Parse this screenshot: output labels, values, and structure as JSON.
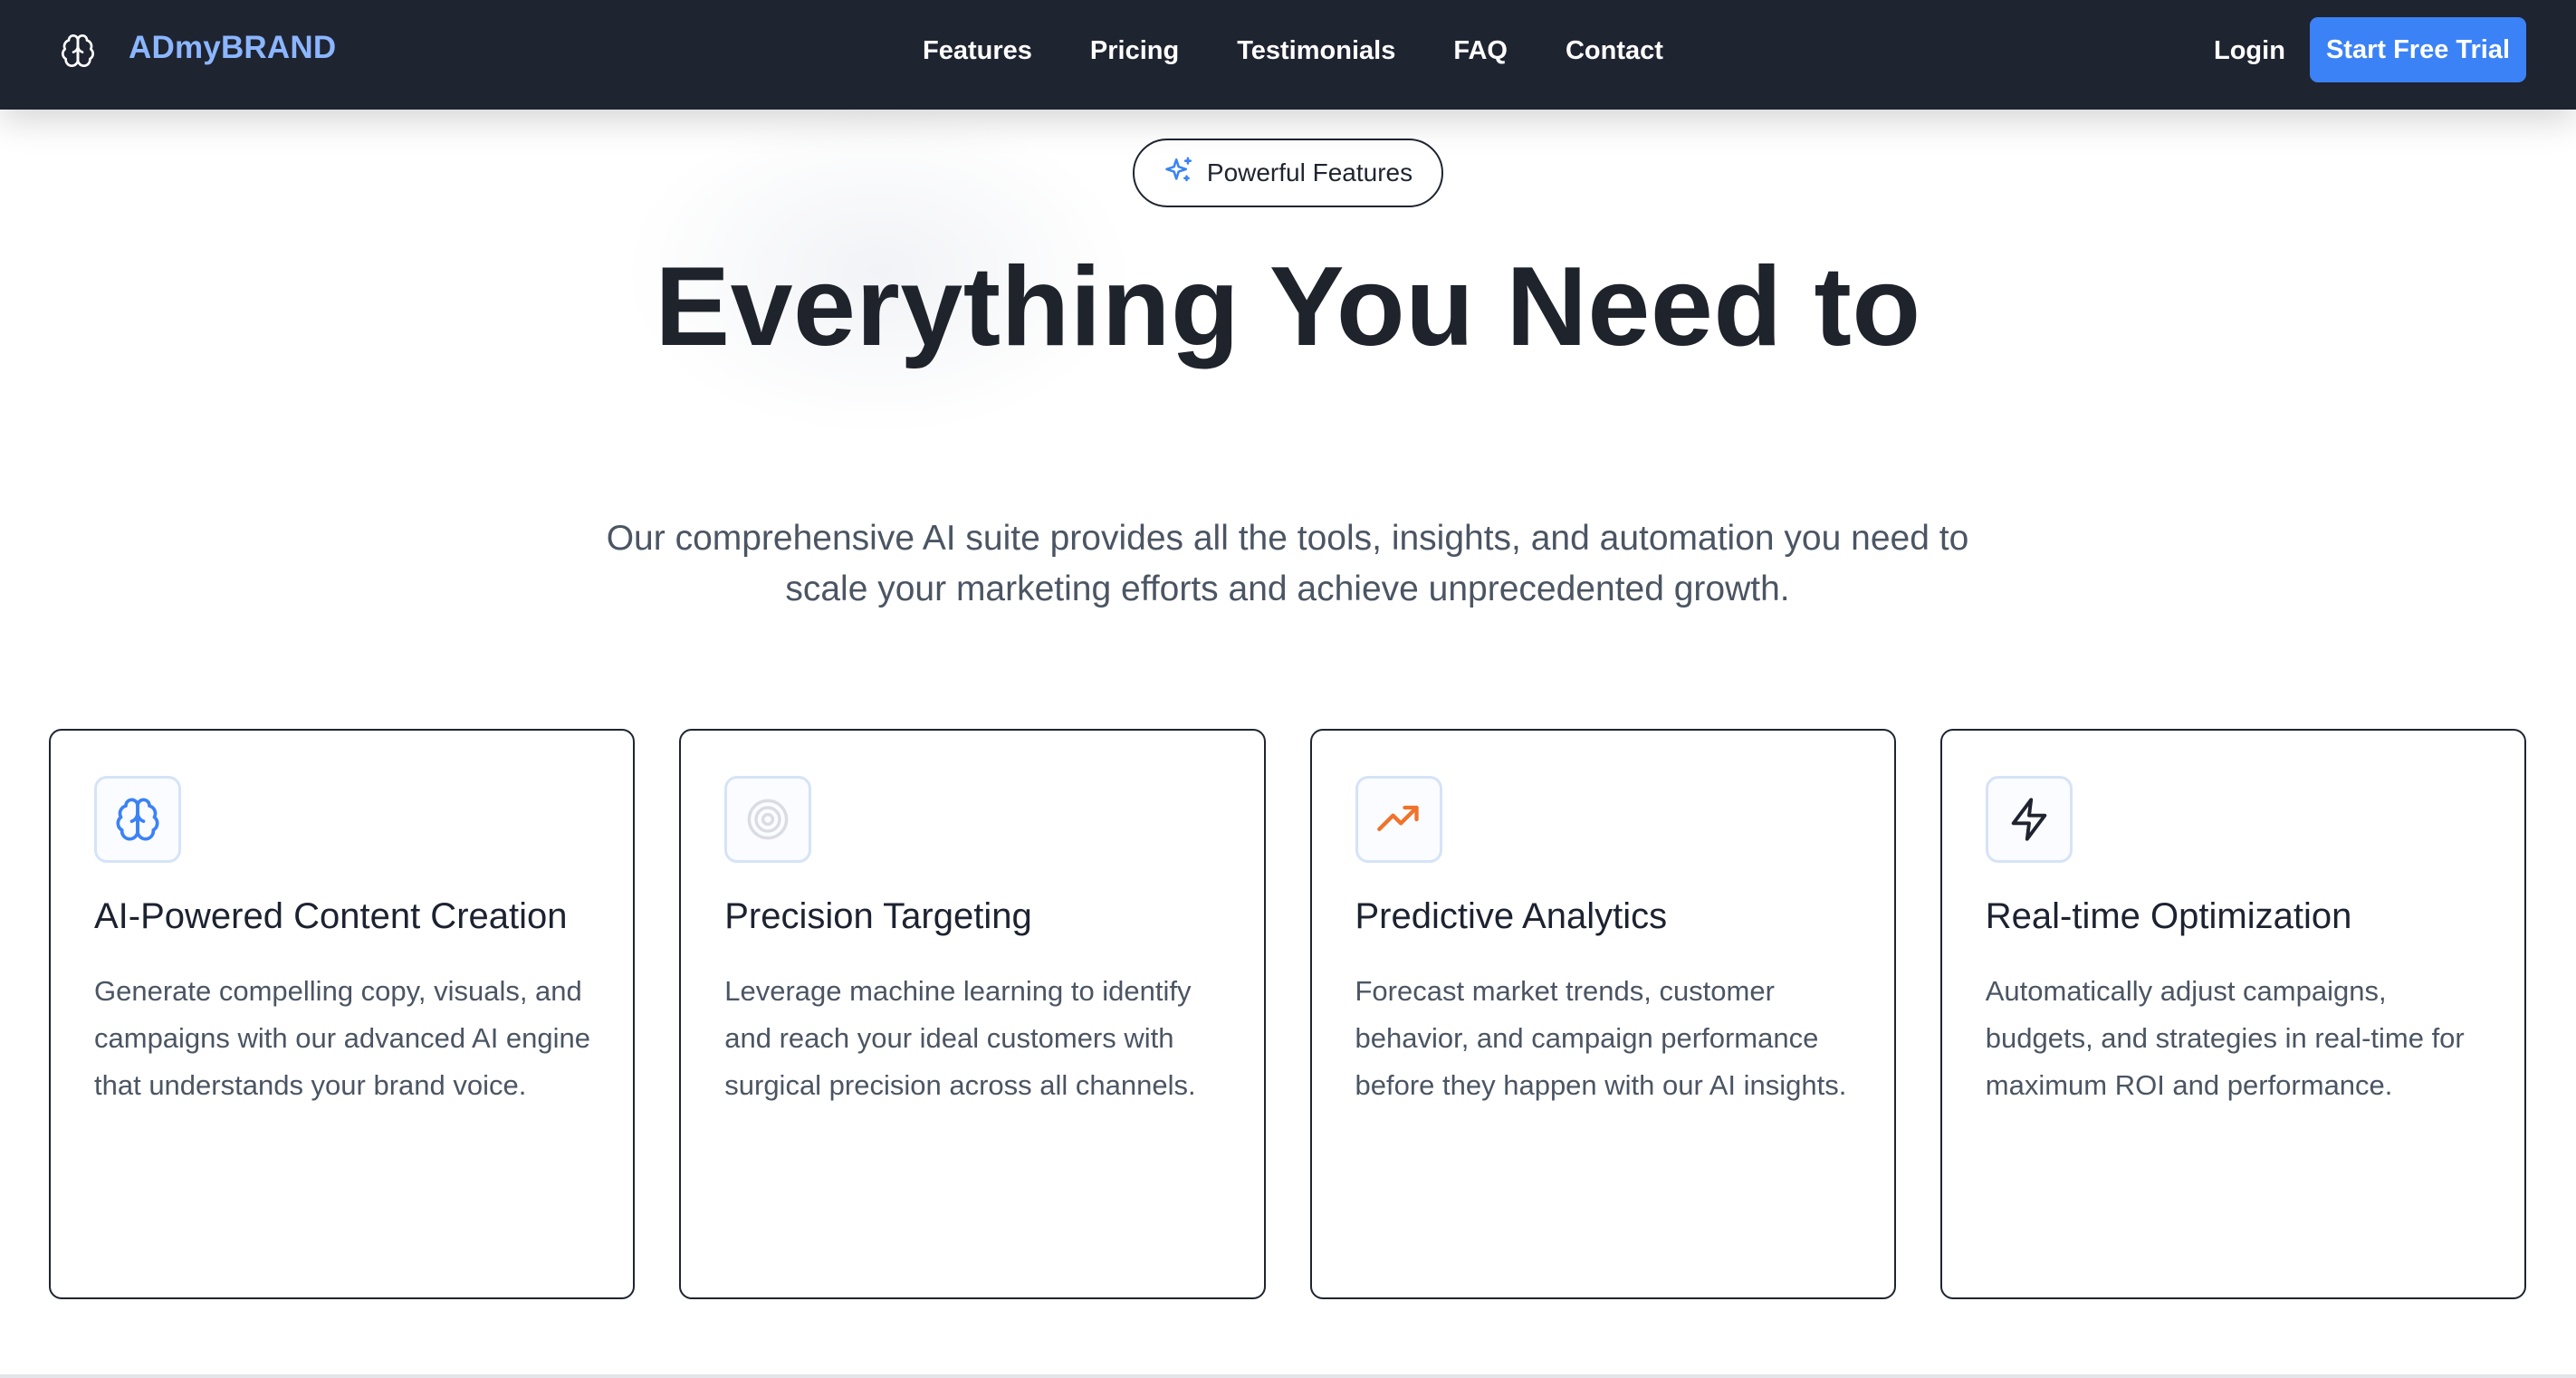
{
  "brand": {
    "name": "ADmyBRAND",
    "icon": "brain-icon",
    "color": "#8bb6ff"
  },
  "nav": {
    "links": [
      "Features",
      "Pricing",
      "Testimonials",
      "FAQ",
      "Contact"
    ],
    "login": "Login",
    "cta": "Start Free Trial",
    "background": "#1f2431",
    "accent": "#3b82f6"
  },
  "hero": {
    "badge": {
      "icon": "sparkles-icon",
      "label": "Powerful Features"
    },
    "title": "Everything You Need to",
    "subtitle": "Our comprehensive AI suite provides all the tools, insights, and automation you need to scale your marketing efforts and achieve unprecedented growth."
  },
  "features": [
    {
      "icon": "brain-icon",
      "title": "AI-Powered Content Creation",
      "description": "Generate compelling copy, visuals, and campaigns with our advanced AI engine that understands your brand voice."
    },
    {
      "icon": "target-icon",
      "title": "Precision Targeting",
      "description": "Leverage machine learning to identify and reach your ideal customers with surgical precision across all channels."
    },
    {
      "icon": "trending-up-icon",
      "title": "Predictive Analytics",
      "description": "Forecast market trends, customer behavior, and campaign performance before they happen with our AI insights."
    },
    {
      "icon": "lightning-icon",
      "title": "Real-time Optimization",
      "description": "Automatically adjust campaigns, budgets, and strategies in real-time for maximum ROI and performance."
    }
  ]
}
